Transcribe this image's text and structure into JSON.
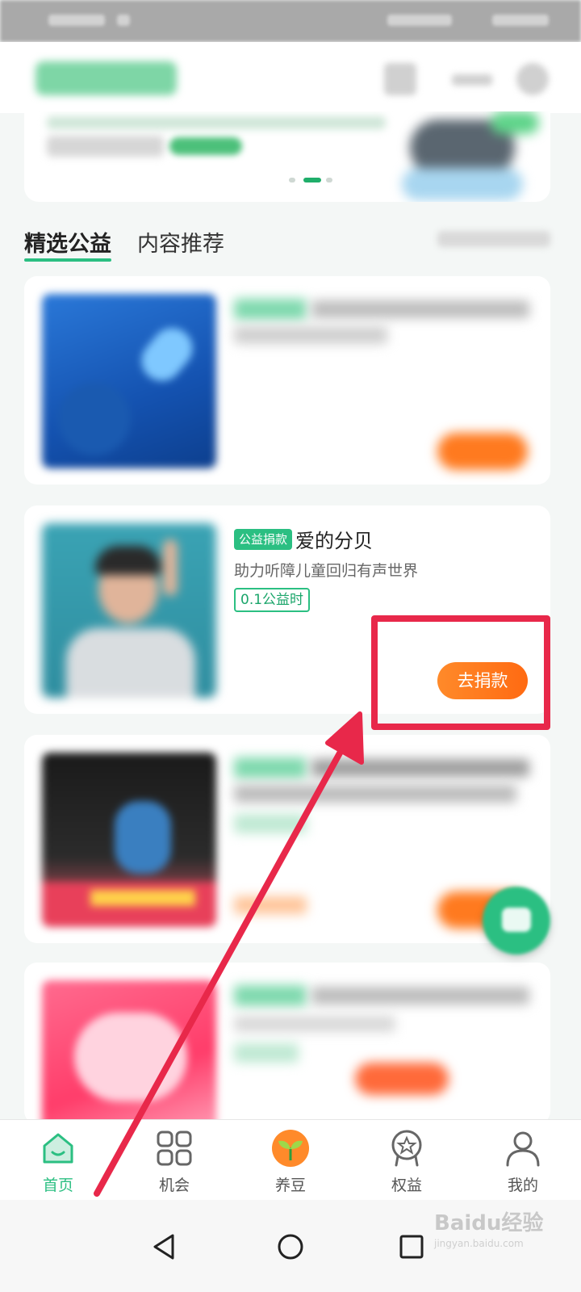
{
  "tabs": [
    {
      "label": "精选公益"
    },
    {
      "label": "内容推荐"
    }
  ],
  "cards": [
    {
      "tag": "公益捐款",
      "title": "爱的分贝",
      "description": "助力听障儿童回归有声世界",
      "hours_badge": "0.1公益时",
      "action_label": "去捐款"
    }
  ],
  "bottom_nav": {
    "items": [
      {
        "label": "首页",
        "icon": "home-icon"
      },
      {
        "label": "机会",
        "icon": "grid-icon"
      },
      {
        "label": "养豆",
        "icon": "sprout-icon"
      },
      {
        "label": "权益",
        "icon": "badge-icon"
      },
      {
        "label": "我的",
        "icon": "person-icon"
      }
    ],
    "active_index": 0
  },
  "android_nav": [
    "back-icon",
    "home-circle-icon",
    "recents-icon"
  ],
  "watermark": {
    "text": "Baidu经验",
    "sub": "jingyan.baidu.com"
  },
  "colors": {
    "brand_green": "#2bbf82",
    "action_orange": "#ff7a1f",
    "highlight_red": "#e8284a"
  }
}
